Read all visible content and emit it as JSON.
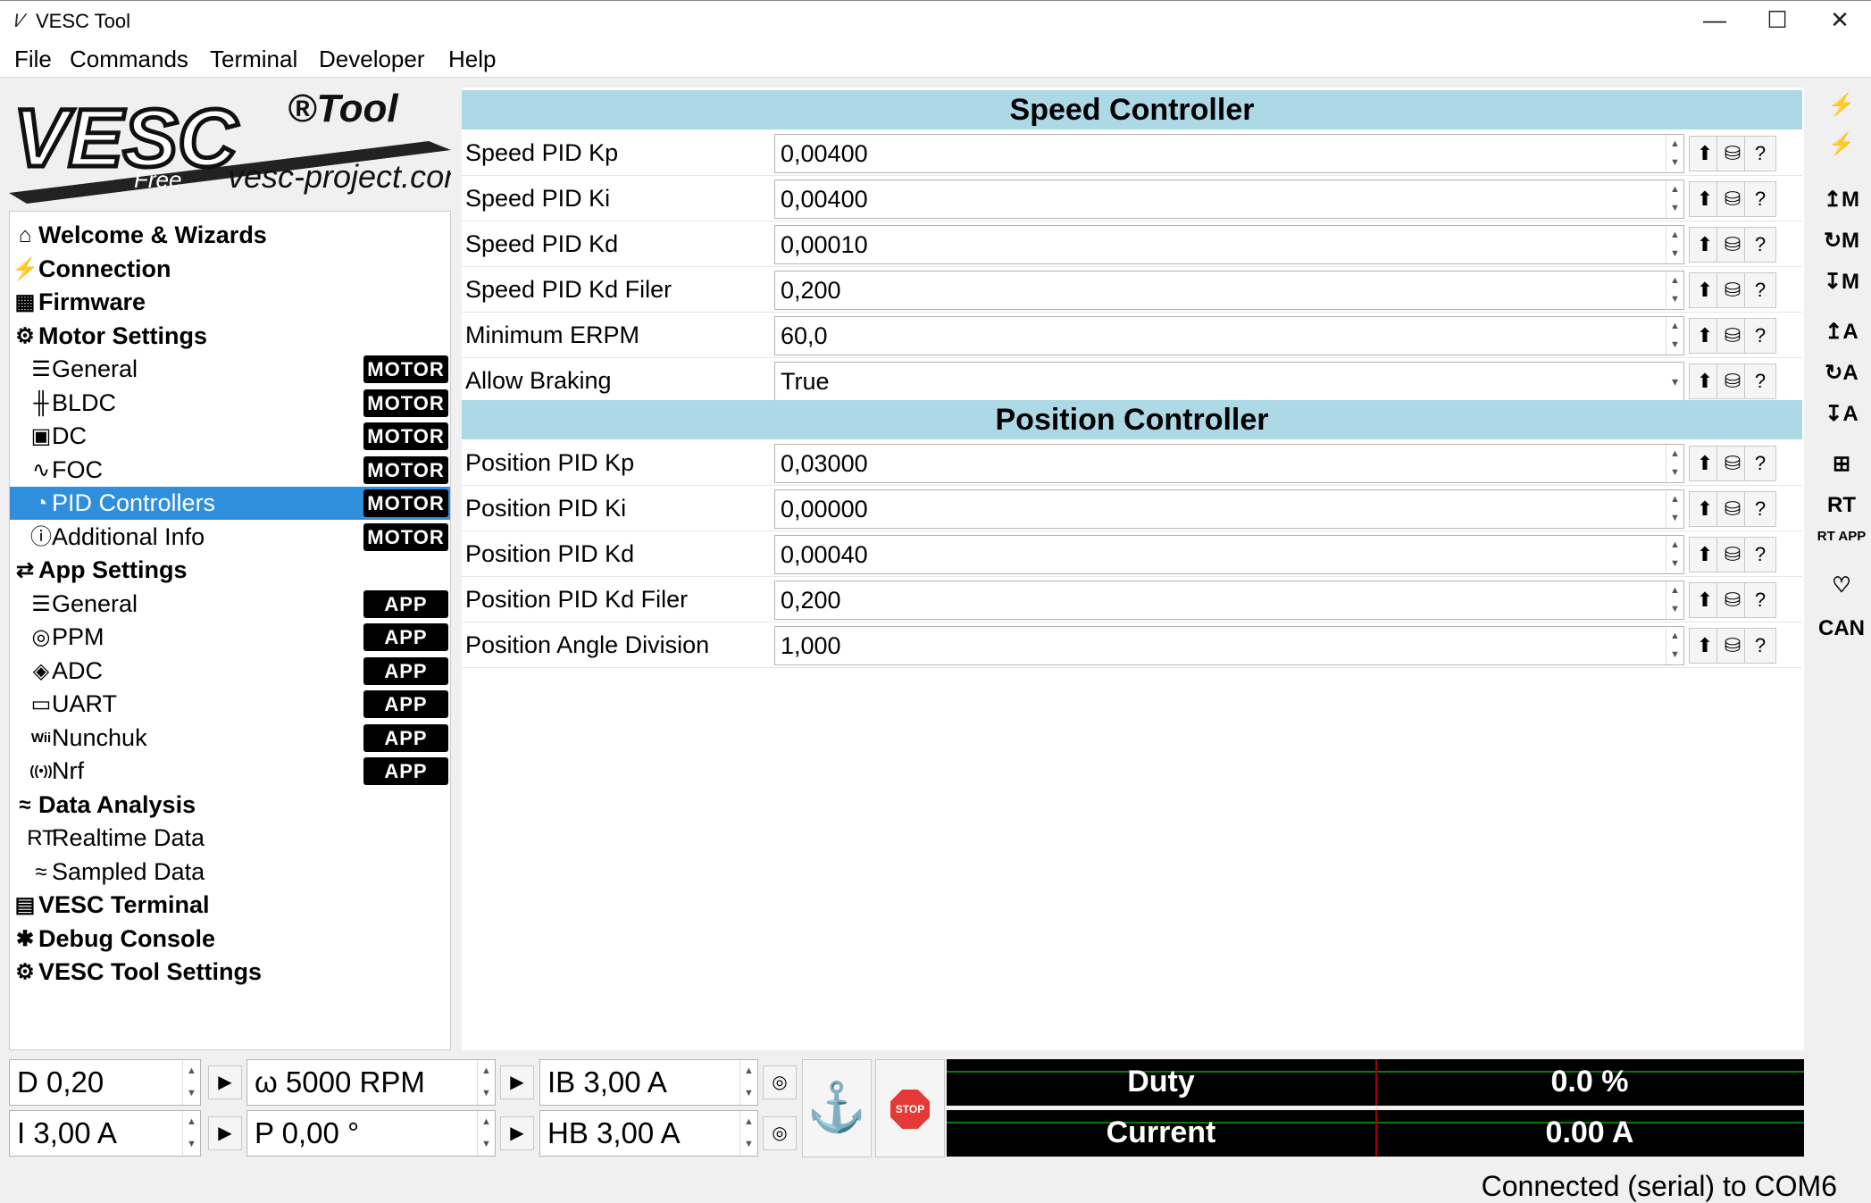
{
  "window": {
    "title": "VESC Tool",
    "minimize": "—",
    "maximize": "☐",
    "close": "✕"
  },
  "menu": [
    "File",
    "Commands",
    "Terminal",
    "Developer",
    "Help"
  ],
  "logo": {
    "main": "VESC",
    "tool": "®Tool",
    "free": "Free",
    "site": "vesc-project.com"
  },
  "tree": [
    {
      "label": "Welcome & Wizards",
      "icon": "home-icon",
      "glyph": "⌂",
      "level": 0
    },
    {
      "label": "Connection",
      "icon": "plug-icon",
      "glyph": "⚡",
      "level": 0
    },
    {
      "label": "Firmware",
      "icon": "chip-icon",
      "glyph": "▦",
      "level": 0
    },
    {
      "label": "Motor Settings",
      "icon": "motor-icon",
      "glyph": "⚙",
      "level": 0
    },
    {
      "label": "General",
      "icon": "sliders-icon",
      "glyph": "☰",
      "level": 1,
      "tag": "MOTOR"
    },
    {
      "label": "BLDC",
      "icon": "bldc-icon",
      "glyph": "╫",
      "level": 1,
      "tag": "MOTOR"
    },
    {
      "label": "DC",
      "icon": "battery-icon",
      "glyph": "▣",
      "level": 1,
      "tag": "MOTOR"
    },
    {
      "label": "FOC",
      "icon": "foc-icon",
      "glyph": "∿",
      "level": 1,
      "tag": "MOTOR"
    },
    {
      "label": "PID Controllers",
      "icon": "gauge-icon",
      "glyph": "◔",
      "level": 1,
      "tag": "MOTOR",
      "selected": true
    },
    {
      "label": "Additional Info",
      "icon": "info-icon",
      "glyph": "ⓘ",
      "level": 1,
      "tag": "MOTOR"
    },
    {
      "label": "App Settings",
      "icon": "app-icon",
      "glyph": "⇄",
      "level": 0
    },
    {
      "label": "General",
      "icon": "sliders-icon",
      "glyph": "☰",
      "level": 1,
      "tag": "APP"
    },
    {
      "label": "PPM",
      "icon": "gamepad-icon",
      "glyph": "◎",
      "level": 1,
      "tag": "APP"
    },
    {
      "label": "ADC",
      "icon": "adc-icon",
      "glyph": "◈",
      "level": 1,
      "tag": "APP"
    },
    {
      "label": "UART",
      "icon": "serial-icon",
      "glyph": "▭",
      "level": 1,
      "tag": "APP"
    },
    {
      "label": "Nunchuk",
      "icon": "wii-icon",
      "glyph": "Wii",
      "level": 1,
      "tag": "APP"
    },
    {
      "label": "Nrf",
      "icon": "wireless-icon",
      "glyph": "((•))",
      "level": 1,
      "tag": "APP"
    },
    {
      "label": "Data Analysis",
      "icon": "chart-icon",
      "glyph": "≈",
      "level": 0
    },
    {
      "label": "Realtime Data",
      "icon": "rt-icon",
      "glyph": "RT",
      "level": 1
    },
    {
      "label": "Sampled Data",
      "icon": "sampled-icon",
      "glyph": "≈",
      "level": 1
    },
    {
      "label": "VESC Terminal",
      "icon": "terminal-icon",
      "glyph": "▤",
      "level": 0
    },
    {
      "label": "Debug Console",
      "icon": "bug-icon",
      "glyph": "✱",
      "level": 0
    },
    {
      "label": "VESC Tool Settings",
      "icon": "gear-icon",
      "glyph": "⚙",
      "level": 0
    }
  ],
  "content": {
    "speed": {
      "title": "Speed Controller",
      "rows": [
        {
          "label": "Speed PID Kp",
          "value": "0,00400"
        },
        {
          "label": "Speed PID Ki",
          "value": "0,00400"
        },
        {
          "label": "Speed PID Kd",
          "value": "0,00010"
        },
        {
          "label": "Speed PID Kd Filer",
          "value": "0,200"
        },
        {
          "label": "Minimum ERPM",
          "value": "60,0"
        },
        {
          "label": "Allow Braking",
          "value": "True",
          "dropdown": true
        }
      ]
    },
    "position": {
      "title": "Position Controller",
      "rows": [
        {
          "label": "Position PID Kp",
          "value": "0,03000"
        },
        {
          "label": "Position PID Ki",
          "value": "0,00000"
        },
        {
          "label": "Position PID Kd",
          "value": "0,00040"
        },
        {
          "label": "Position PID Kd Filer",
          "value": "0,200"
        },
        {
          "label": "Position Angle Division",
          "value": "1,000"
        }
      ]
    }
  },
  "rowbuttons": {
    "write": "⬆",
    "read": "⛁",
    "help": "?"
  },
  "righttool": [
    {
      "name": "connect-icon",
      "glyph": "⚡"
    },
    {
      "name": "disconnect-icon",
      "glyph": "⚡"
    },
    {
      "name": "write-motor-icon",
      "glyph": "↥M"
    },
    {
      "name": "reread-motor-icon",
      "glyph": "↻M"
    },
    {
      "name": "default-motor-icon",
      "glyph": "↧M"
    },
    {
      "name": "write-app-icon",
      "glyph": "↥A"
    },
    {
      "name": "reread-app-icon",
      "glyph": "↻A"
    },
    {
      "name": "default-app-icon",
      "glyph": "↧A"
    },
    {
      "name": "tree-icon",
      "glyph": "⊞"
    },
    {
      "name": "realtime-icon",
      "glyph": "RT"
    },
    {
      "name": "realtime-app-icon",
      "glyph": "RT APP"
    },
    {
      "name": "heart-icon",
      "glyph": "♡"
    },
    {
      "name": "can-icon",
      "glyph": "CAN"
    }
  ],
  "controls": {
    "duty": "D 0,20",
    "current": "I 3,00 A",
    "rpm": "ω 5000 RPM",
    "position": "P 0,00 °",
    "brake": "IB 3,00 A",
    "handbrake": "HB 3,00 A",
    "anchor": "⚓",
    "stop": "STOP"
  },
  "gauges": [
    {
      "label": "Duty",
      "value": "0.0 %"
    },
    {
      "label": "Current",
      "value": "0.00 A"
    }
  ],
  "status": "Connected (serial) to COM6"
}
